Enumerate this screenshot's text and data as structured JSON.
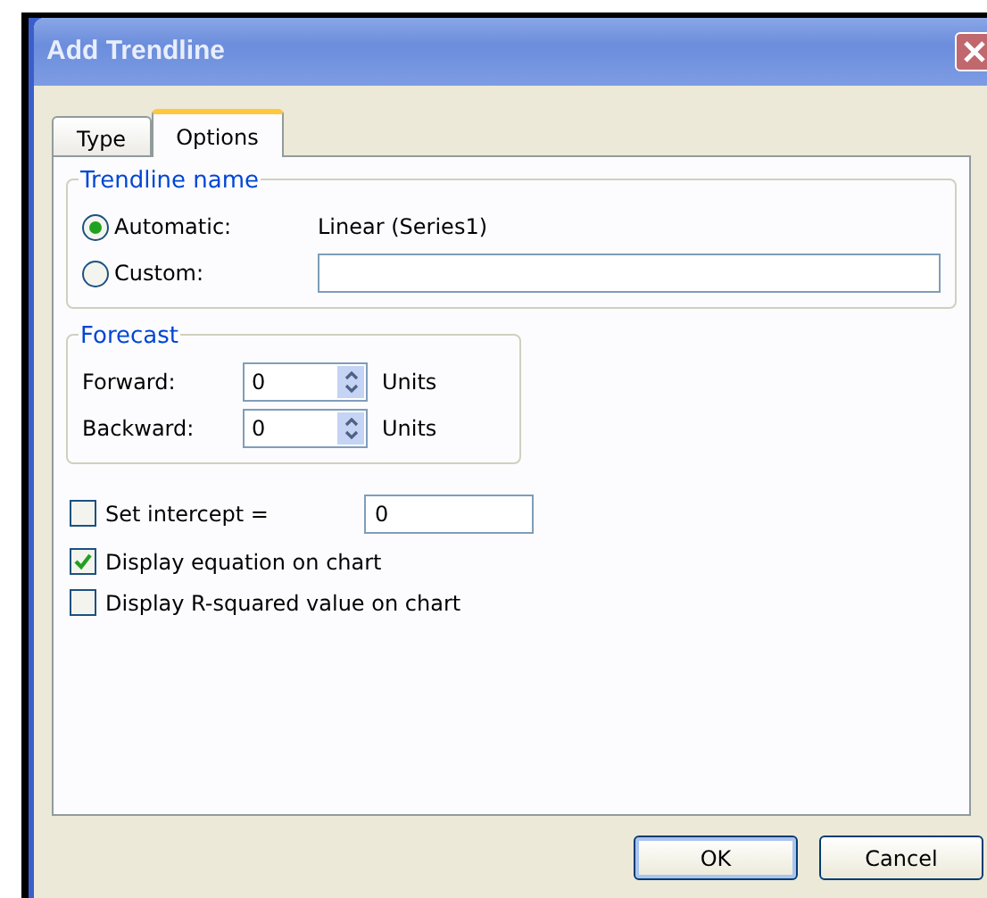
{
  "window": {
    "title": "Add Trendline"
  },
  "tabs": [
    {
      "label": "Type",
      "selected": false
    },
    {
      "label": "Options",
      "selected": true
    }
  ],
  "trendline_name": {
    "title": "Trendline name",
    "options": [
      {
        "label": "Automatic:",
        "selected": true,
        "value": "Linear (Series1)",
        "kind": "text"
      },
      {
        "label": "Custom:",
        "selected": false,
        "kind": "field"
      }
    ]
  },
  "forecast": {
    "title": "Forecast",
    "rows": [
      {
        "label": "Forward:",
        "value": "0",
        "unit": "Units"
      },
      {
        "label": "Backward:",
        "value": "0",
        "unit": "Units"
      }
    ]
  },
  "checks": [
    {
      "label": "Set intercept =",
      "checked": false,
      "value": "0"
    },
    {
      "label": "Display equation on chart",
      "checked": true
    },
    {
      "label": "Display R-squared value on chart",
      "checked": false
    }
  ],
  "buttons": [
    "OK",
    "Cancel"
  ]
}
